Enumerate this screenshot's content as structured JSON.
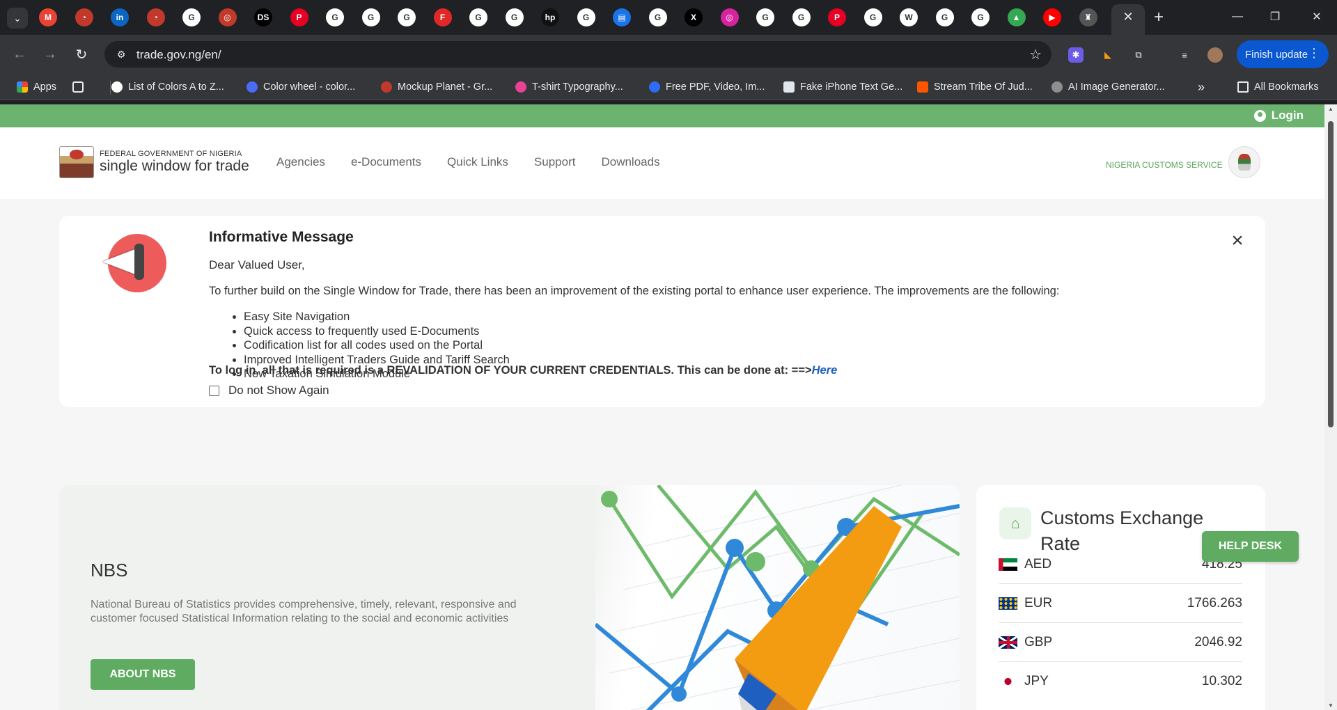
{
  "browser": {
    "url": "trade.gov.ng/en/",
    "finish_update_label": "Finish update",
    "pinned_tab_icons": [
      "gmail-icon",
      "speed-icon",
      "linkedin-icon",
      "speed-icon",
      "google-icon",
      "target-icon",
      "ds-icon",
      "pinterest-icon",
      "google-icon",
      "google-icon",
      "google-icon",
      "flipboard-icon",
      "google-icon",
      "google-icon",
      "hp-icon",
      "google-icon",
      "forms-icon",
      "google-icon",
      "x-icon",
      "instagram-icon",
      "google-icon",
      "google-icon",
      "pinterest-icon",
      "google-icon",
      "wikipedia-icon",
      "google-icon",
      "google-icon",
      "drive-icon",
      "youtube-icon",
      "crest-icon"
    ],
    "bookmarks": [
      {
        "label": "Apps"
      },
      {
        "label": "List of Colors A to Z..."
      },
      {
        "label": "Color wheel - color..."
      },
      {
        "label": "Mockup Planet - Gr..."
      },
      {
        "label": "T-shirt Typography..."
      },
      {
        "label": "Free PDF, Video, Im..."
      },
      {
        "label": "Fake iPhone Text Ge..."
      },
      {
        "label": "Stream Tribe Of Jud..."
      },
      {
        "label": "AI Image Generator..."
      }
    ],
    "all_bookmarks_label": "All Bookmarks"
  },
  "site": {
    "login_label": "Login",
    "logo_line1": "FEDERAL GOVERNMENT OF NIGERIA",
    "logo_line2": "single window for trade",
    "menu": [
      "Agencies",
      "e-Documents",
      "Quick Links",
      "Support",
      "Downloads"
    ],
    "ncs_label": "NIGERIA CUSTOMS SERVICE"
  },
  "message": {
    "title": "Informative Message",
    "greeting": "Dear Valued User,",
    "body": "To further build on the Single Window for Trade, there has been an improvement of the existing portal to enhance user experience. The improvements are the following:",
    "items": [
      "Easy Site Navigation",
      "Quick access to frequently used E-Documents",
      "Codification list for all codes used on the Portal",
      "Improved Intelligent Traders Guide and Tariff Search",
      "New Taxation Simulation Module"
    ],
    "login_text": "To log in, all that is required is a REVALIDATION OF YOUR CURRENT CREDENTIALS. This can be done at: ==>",
    "here_link": "Here",
    "checkbox_label": "Do not Show Again"
  },
  "nbs": {
    "title": "NBS",
    "description": "National Bureau of Statistics provides comprehensive, timely, relevant, responsive and customer focused Statistical Information relating to the social and economic activities",
    "button": "ABOUT NBS"
  },
  "exchange": {
    "title": "Customs Exchange Rate",
    "rates": [
      {
        "code": "AED",
        "value": "418.25"
      },
      {
        "code": "EUR",
        "value": "1766.263"
      },
      {
        "code": "GBP",
        "value": "2046.92"
      },
      {
        "code": "JPY",
        "value": "10.302"
      }
    ]
  },
  "helpdesk_label": "HELP DESK",
  "colors": {
    "brand_green": "#6cb36f",
    "button_green": "#5eab61",
    "link_blue": "#1f5fbf"
  }
}
